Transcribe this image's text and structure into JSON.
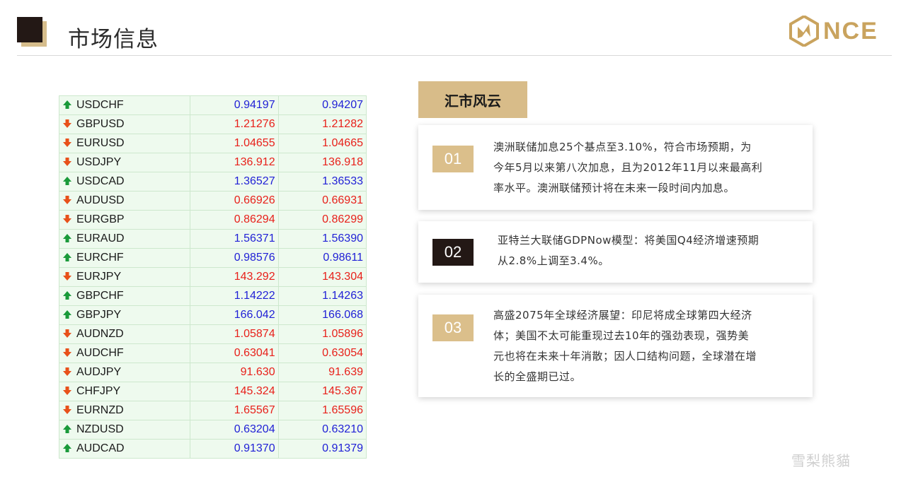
{
  "header": {
    "title": "市场信息",
    "logo_text": "NCE"
  },
  "fx_table": {
    "rows": [
      {
        "symbol": "USDCHF",
        "bid": "0.94197",
        "ask": "0.94207",
        "direction": "up",
        "color": "blue"
      },
      {
        "symbol": "GBPUSD",
        "bid": "1.21276",
        "ask": "1.21282",
        "direction": "down",
        "color": "red"
      },
      {
        "symbol": "EURUSD",
        "bid": "1.04655",
        "ask": "1.04665",
        "direction": "down",
        "color": "red"
      },
      {
        "symbol": "USDJPY",
        "bid": "136.912",
        "ask": "136.918",
        "direction": "down",
        "color": "red"
      },
      {
        "symbol": "USDCAD",
        "bid": "1.36527",
        "ask": "1.36533",
        "direction": "up",
        "color": "blue"
      },
      {
        "symbol": "AUDUSD",
        "bid": "0.66926",
        "ask": "0.66931",
        "direction": "down",
        "color": "red"
      },
      {
        "symbol": "EURGBP",
        "bid": "0.86294",
        "ask": "0.86299",
        "direction": "down",
        "color": "red"
      },
      {
        "symbol": "EURAUD",
        "bid": "1.56371",
        "ask": "1.56390",
        "direction": "up",
        "color": "blue"
      },
      {
        "symbol": "EURCHF",
        "bid": "0.98576",
        "ask": "0.98611",
        "direction": "up",
        "color": "blue"
      },
      {
        "symbol": "EURJPY",
        "bid": "143.292",
        "ask": "143.304",
        "direction": "down",
        "color": "red"
      },
      {
        "symbol": "GBPCHF",
        "bid": "1.14222",
        "ask": "1.14263",
        "direction": "up",
        "color": "blue"
      },
      {
        "symbol": "GBPJPY",
        "bid": "166.042",
        "ask": "166.068",
        "direction": "up",
        "color": "blue"
      },
      {
        "symbol": "AUDNZD",
        "bid": "1.05874",
        "ask": "1.05896",
        "direction": "down",
        "color": "red"
      },
      {
        "symbol": "AUDCHF",
        "bid": "0.63041",
        "ask": "0.63054",
        "direction": "down",
        "color": "red"
      },
      {
        "symbol": "AUDJPY",
        "bid": "91.630",
        "ask": "91.639",
        "direction": "down",
        "color": "red"
      },
      {
        "symbol": "CHFJPY",
        "bid": "145.324",
        "ask": "145.367",
        "direction": "down",
        "color": "red"
      },
      {
        "symbol": "EURNZD",
        "bid": "1.65567",
        "ask": "1.65596",
        "direction": "down",
        "color": "red"
      },
      {
        "symbol": "NZDUSD",
        "bid": "0.63204",
        "ask": "0.63210",
        "direction": "up",
        "color": "blue"
      },
      {
        "symbol": "AUDCAD",
        "bid": "0.91370",
        "ask": "0.91379",
        "direction": "up",
        "color": "blue"
      }
    ],
    "up_color": "#1a9a3a",
    "down_color": "#e8501a"
  },
  "news": {
    "title": "汇市风云",
    "items": [
      {
        "num": "01",
        "lines": [
          "澳洲联储加息25个基点至3.10%，符合市场预期，为",
          "今年5月以来第八次加息，且为2012年11月以来最高利",
          "率水平。澳洲联储预计将在未来一段时间内加息。"
        ]
      },
      {
        "num": "02",
        "lines": [
          "亚特兰大联储GDPNow模型：将美国Q4经济增速预期",
          "从2.8%上调至3.4%。"
        ]
      },
      {
        "num": "03",
        "lines": [
          "高盛2075年全球经济展望：印尼将成全球第四大经济",
          "体；美国不太可能重现过去10年的强劲表现，强势美",
          "元也将在未来十年消散；因人口结构问题，全球潜在增",
          "长的全盛期已过。"
        ]
      }
    ]
  },
  "watermark": "雪梨熊貓",
  "colors": {
    "gold": "#d8bc89",
    "dark": "#231815",
    "blue": "#1f1fd6",
    "red": "#e8201a"
  }
}
